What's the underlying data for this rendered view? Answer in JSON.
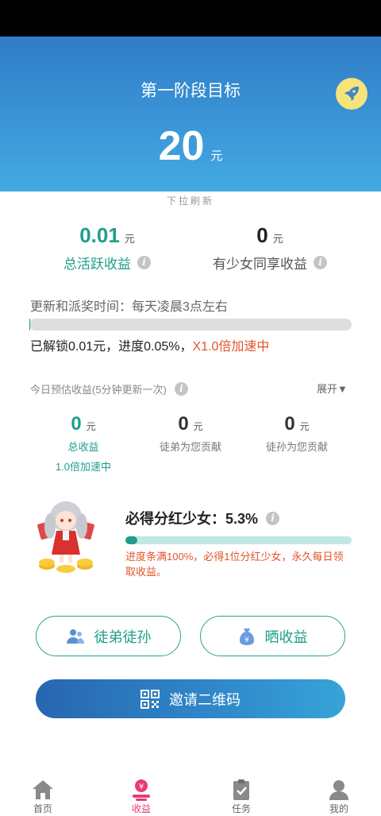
{
  "hero": {
    "title": "第一阶段目标",
    "amount": "20",
    "unit": "元"
  },
  "pull_hint": "下拉刷新",
  "stats": {
    "active_income": {
      "value": "0.01",
      "unit": "元",
      "label": "总活跃收益"
    },
    "girl_share": {
      "value": "0",
      "unit": "元",
      "label": "有少女同享收益"
    }
  },
  "update": {
    "text": "更新和派奖时间：每天凌晨3点左右",
    "progress_fraction": 0.0005,
    "unlock_text": "已解锁0.01元，进度0.05%，",
    "accel_text": "X1.0倍加速中"
  },
  "today": {
    "title": "今日预估收益(5分钟更新一次)",
    "expand_label": "展开▼",
    "total": {
      "value": "0",
      "unit": "元",
      "label": "总收益",
      "sub": "1.0倍加速中"
    },
    "disciple": {
      "value": "0",
      "unit": "元",
      "label": "徒弟为您贡献"
    },
    "grand_disciple": {
      "value": "0",
      "unit": "元",
      "label": "徒孙为您贡献"
    }
  },
  "bonus": {
    "title": "必得分红少女：",
    "percent": "5.3%",
    "progress_fraction": 0.053,
    "desc": "进度条满100%，必得1位分红少女，永久每日领取收益。"
  },
  "buttons": {
    "disciples": "徒弟徒孙",
    "show_income": "晒收益",
    "invite_qr": "邀请二维码"
  },
  "tabs": [
    {
      "label": "首页"
    },
    {
      "label": "收益"
    },
    {
      "label": "任务"
    },
    {
      "label": "我的"
    }
  ],
  "colors": {
    "teal": "#1f9e8a",
    "orange_red": "#e2552b",
    "active_tab": "#e83a78",
    "hero_blue": "#3a95d6"
  }
}
